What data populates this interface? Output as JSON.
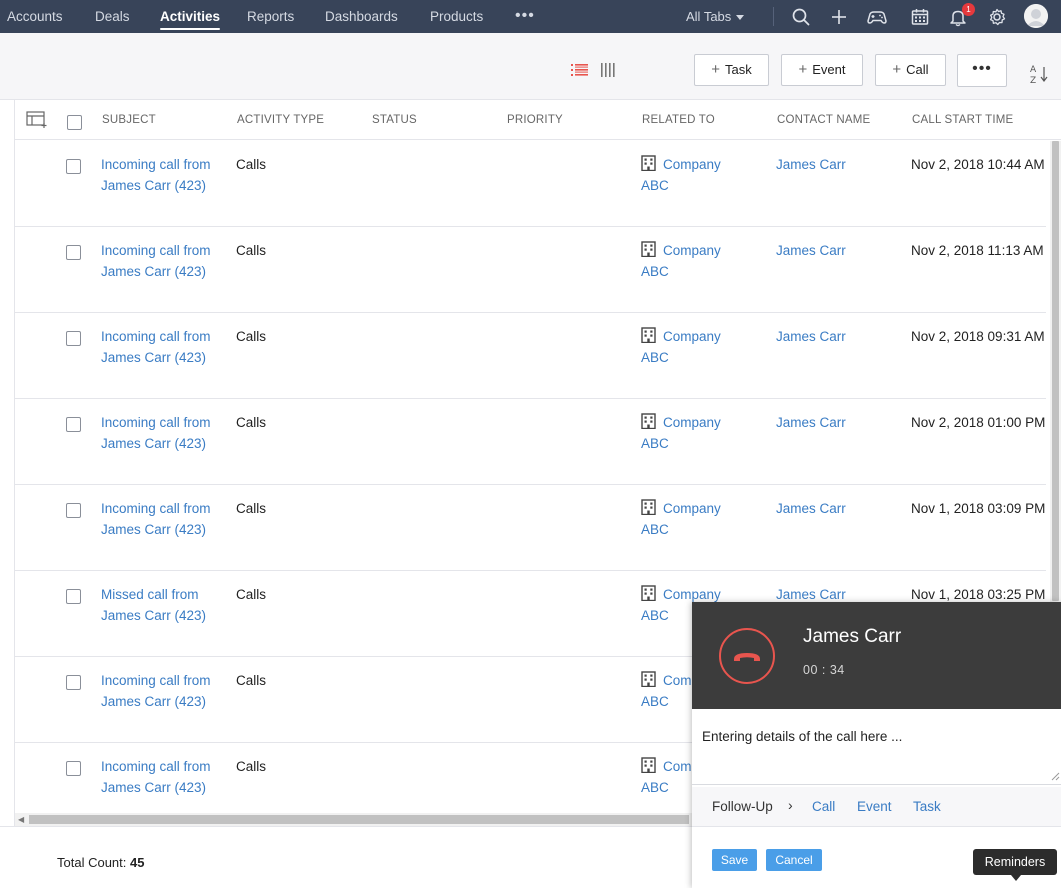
{
  "nav": {
    "items": [
      "Accounts",
      "Deals",
      "Activities",
      "Reports",
      "Dashboards",
      "Products"
    ],
    "active": "Activities",
    "all_tabs": "All Tabs",
    "notification_count": "1",
    "icons": [
      "search-icon",
      "plus-icon",
      "gamepad-icon",
      "calendar-icon",
      "bell-icon",
      "gear-icon",
      "avatar"
    ]
  },
  "toolbar": {
    "task_label": "Task",
    "event_label": "Event",
    "call_label": "Call",
    "more_label": "•••"
  },
  "table": {
    "columns": [
      "SUBJECT",
      "ACTIVITY TYPE",
      "STATUS",
      "PRIORITY",
      "RELATED TO",
      "CONTACT NAME",
      "CALL START TIME"
    ],
    "rows": [
      {
        "subject": "Incoming call from James Carr (423)",
        "type": "Calls",
        "status": "",
        "priority": "",
        "related": "Company ABC",
        "contact": "James Carr",
        "start": "Nov 2, 2018 10:44 AM"
      },
      {
        "subject": "Incoming call from James Carr (423)",
        "type": "Calls",
        "status": "",
        "priority": "",
        "related": "Company ABC",
        "contact": "James Carr",
        "start": "Nov 2, 2018 11:13 AM"
      },
      {
        "subject": "Incoming call from James Carr (423)",
        "type": "Calls",
        "status": "",
        "priority": "",
        "related": "Company ABC",
        "contact": "James Carr",
        "start": "Nov 2, 2018 09:31 AM"
      },
      {
        "subject": "Incoming call from James Carr (423)",
        "type": "Calls",
        "status": "",
        "priority": "",
        "related": "Company ABC",
        "contact": "James Carr",
        "start": "Nov 2, 2018 01:00 PM"
      },
      {
        "subject": "Incoming call from James Carr (423)",
        "type": "Calls",
        "status": "",
        "priority": "",
        "related": "Company ABC",
        "contact": "James Carr",
        "start": "Nov 1, 2018 03:09 PM"
      },
      {
        "subject": "Missed call from James Carr (423)",
        "type": "Calls",
        "status": "",
        "priority": "",
        "related": "Company ABC",
        "contact": "James Carr",
        "start": "Nov 1, 2018 03:25 PM"
      },
      {
        "subject": "Incoming call from James Carr (423)",
        "type": "Calls",
        "status": "",
        "priority": "",
        "related": "Company ABC",
        "contact": "",
        "start": ""
      },
      {
        "subject": "Incoming call from James Carr (423)",
        "type": "Calls",
        "status": "",
        "priority": "",
        "related": "Company ABC",
        "contact": "",
        "start": ""
      }
    ]
  },
  "footer": {
    "total_label": "Total Count:",
    "total_value": "45"
  },
  "call_widget": {
    "caller": "James Carr",
    "timer": "00 : 34",
    "notes": "Entering details of the call here ...",
    "follow_up_label": "Follow-Up",
    "follow_up_links": [
      "Call",
      "Event",
      "Task"
    ],
    "save_label": "Save",
    "cancel_label": "Cancel"
  },
  "reminders_label": "Reminders",
  "colors": {
    "nav_bg": "#384459",
    "link": "#3a7cc4",
    "hangup": "#e8554e",
    "primary_button": "#4a9ee8",
    "list_view_active": "#e8554e"
  }
}
